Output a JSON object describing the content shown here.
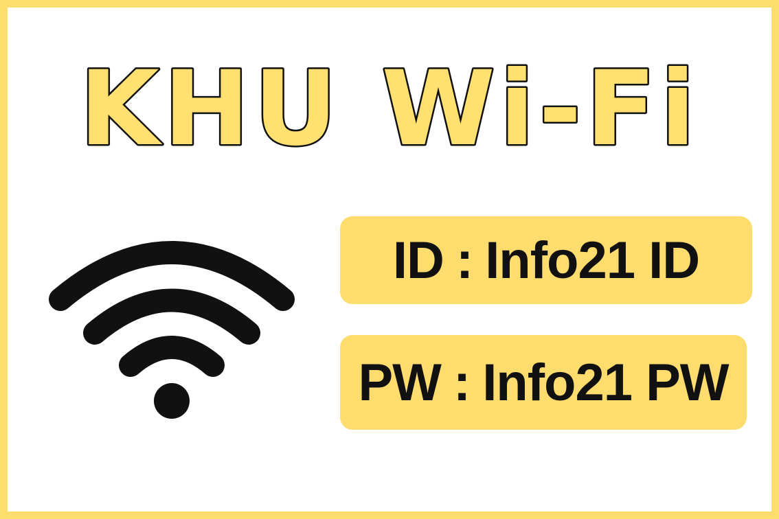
{
  "title": "KHU Wi-Fi",
  "credentials": {
    "id": {
      "label": "ID",
      "separator": ":",
      "value": "Info21 ID"
    },
    "pw": {
      "label": "PW",
      "separator": ":",
      "value": "Info21 PW"
    }
  },
  "icons": {
    "wifi": "wifi-icon"
  },
  "colors": {
    "border": "#fedd6f",
    "accent": "#ffdc6e",
    "title_fill": "#ffe070",
    "text": "#111111",
    "background": "#ffffff"
  }
}
